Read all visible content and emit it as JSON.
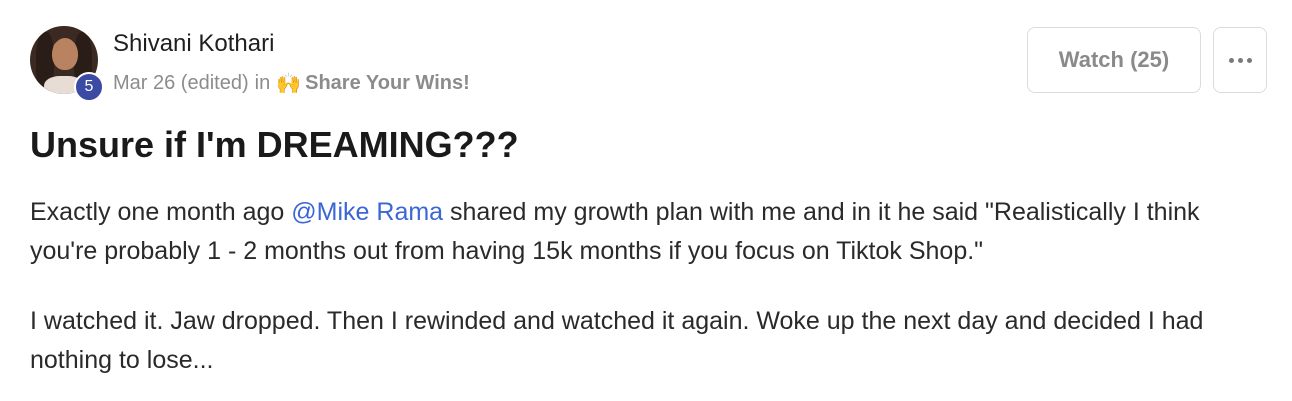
{
  "post": {
    "author": {
      "name": "Shivani Kothari",
      "level": "5"
    },
    "meta": {
      "date": "Mar 26 (edited)",
      "in_label": "in",
      "category_emoji": "🙌",
      "category": "Share Your Wins!"
    },
    "actions": {
      "watch_label": "Watch (25)",
      "more_icon": "ellipsis-icon"
    },
    "title": "Unsure if I'm DREAMING???",
    "body": {
      "p1_before": "Exactly one month ago ",
      "p1_mention": "@Mike Rama",
      "p1_after": " shared my growth plan with me and in it he said \"Realistically I think you're probably 1 - 2 months out from having 15k months if you focus on Tiktok Shop.\"",
      "p2": "I watched it. Jaw dropped. Then I rewinded and watched it again. Woke up the next day and decided I had nothing to lose..."
    }
  }
}
